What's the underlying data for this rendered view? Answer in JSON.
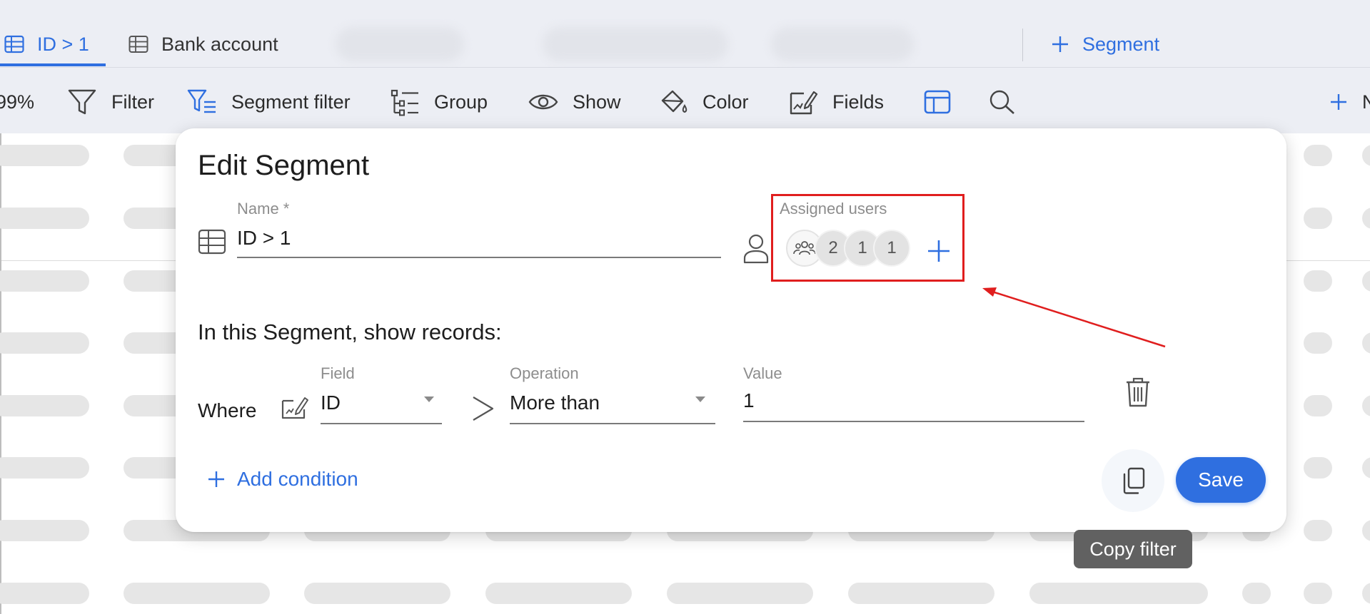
{
  "tabs": [
    {
      "label": "ID > 1",
      "icon": "table-icon",
      "active": true
    },
    {
      "label": "Bank account",
      "icon": "table-icon",
      "active": false
    }
  ],
  "add_segment_label": "Segment",
  "toolbar": {
    "zoom": "99%",
    "filter": "Filter",
    "segment_filter": "Segment filter",
    "group": "Group",
    "show": "Show",
    "color": "Color",
    "fields": "Fields",
    "new_partial": "N"
  },
  "modal": {
    "title": "Edit Segment",
    "name_label": "Name *",
    "name_value": "ID > 1",
    "assigned_users_label": "Assigned users",
    "assigned_users": [
      "2",
      "1",
      "1"
    ],
    "section_heading": "In this Segment, show records:",
    "condition": {
      "where_label": "Where",
      "field_label": "Field",
      "field_value": "ID",
      "operation_label": "Operation",
      "operation_value": "More than",
      "value_label": "Value",
      "value": "1"
    },
    "add_condition_label": "Add condition",
    "save_label": "Save",
    "copy_tooltip": "Copy filter"
  },
  "colors": {
    "accent": "#2f6fe0",
    "highlight": "#e01e1e"
  }
}
